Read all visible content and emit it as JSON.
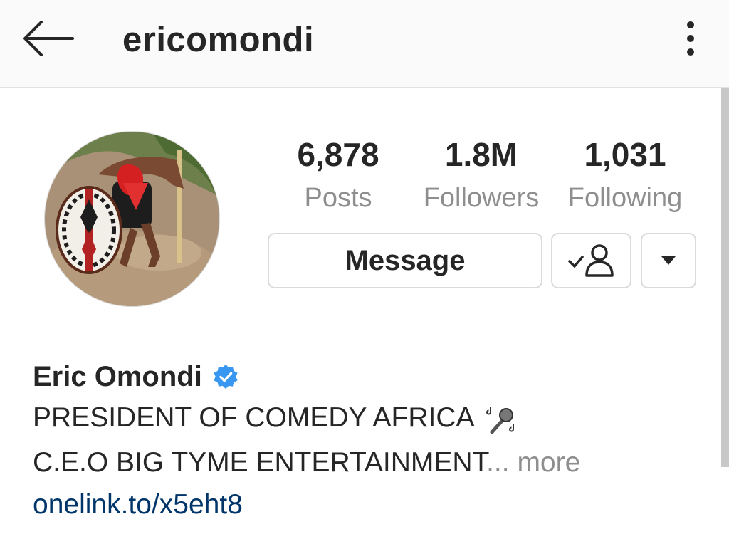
{
  "header": {
    "username": "ericomondi"
  },
  "stats": [
    {
      "value": "6,878",
      "label": "Posts"
    },
    {
      "value": "1.8M",
      "label": "Followers"
    },
    {
      "value": "1,031",
      "label": "Following"
    }
  ],
  "actions": {
    "message_label": "Message"
  },
  "profile": {
    "full_name": "Eric Omondi",
    "bio_line1": "PRESIDENT OF COMEDY AFRICA",
    "bio_line2": "C.E.O BIG TYME ENTERTAINMENT",
    "bio_ellipsis": "...",
    "more_label": " more",
    "link": "onelink.to/x5eht8",
    "bio_emoji": "microphone-icon"
  },
  "colors": {
    "link": "#003569",
    "verified": "#3897f0",
    "secondary_text": "#8e8e8e"
  }
}
